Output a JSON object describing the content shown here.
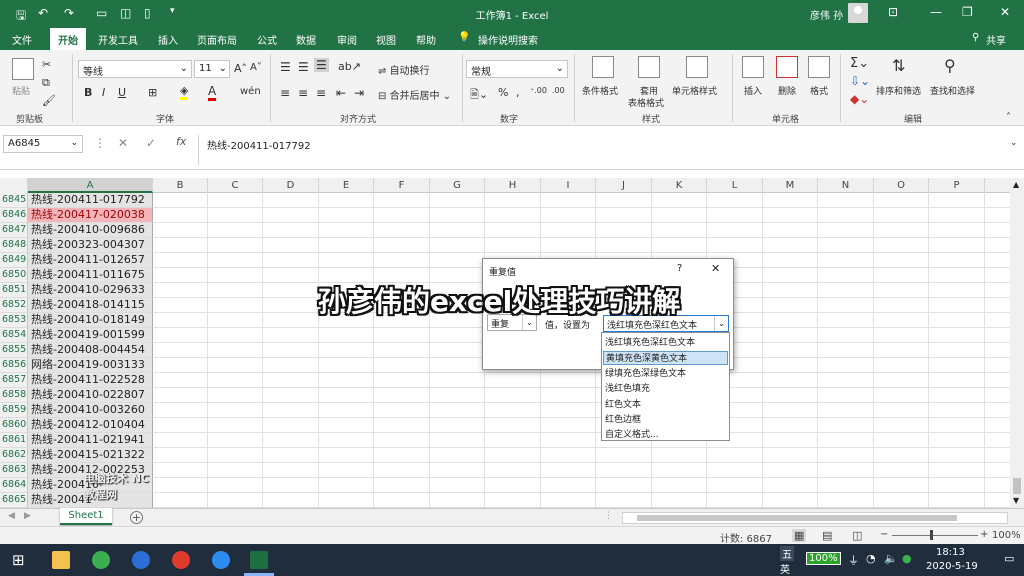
{
  "titlebar": {
    "doc_title": "工作簿1  -  Excel",
    "user_name": "彦伟 孙",
    "quick_access": [
      "save-icon",
      "undo-icon",
      "redo-icon",
      "form-icon",
      "camera-icon",
      "new-icon",
      "customize-icon"
    ]
  },
  "tabs": [
    "文件",
    "开始",
    "开发工具",
    "插入",
    "页面布局",
    "公式",
    "数据",
    "审阅",
    "视图",
    "帮助",
    "操作说明搜索"
  ],
  "share_label": "共享",
  "ribbon": {
    "clipboard": {
      "paste": "粘贴",
      "label": "剪贴板"
    },
    "font": {
      "name": "等线",
      "size": "11",
      "label": "字体",
      "bold": "B",
      "italic": "I",
      "underline": "U"
    },
    "alignment": {
      "wrap": "自动换行",
      "merge": "合并后居中",
      "label": "对齐方式"
    },
    "number": {
      "format": "常规",
      "percent": "%",
      "label": "数字"
    },
    "styles": {
      "conditional": "条件格式",
      "table_fmt_1": "套用",
      "table_fmt_2": "表格格式",
      "cell_style": "单元格样式",
      "label": "样式"
    },
    "cells": {
      "insert": "插入",
      "delete": "删除",
      "format": "格式",
      "label": "单元格"
    },
    "editing": {
      "sort": "排序和筛选",
      "find": "查找和选择",
      "label": "编辑"
    }
  },
  "formula_bar": {
    "name_box": "A6845",
    "fx": "fx",
    "content": "热线-200411-017792"
  },
  "columns": [
    "A",
    "B",
    "C",
    "D",
    "E",
    "F",
    "G",
    "H",
    "I",
    "J",
    "K",
    "L",
    "M",
    "N",
    "O",
    "P"
  ],
  "rows": [
    {
      "num": "6845",
      "value": "热线-200411-017792",
      "dup": false
    },
    {
      "num": "6846",
      "value": "热线-200417-020038",
      "dup": true
    },
    {
      "num": "6847",
      "value": "热线-200410-009686",
      "dup": false
    },
    {
      "num": "6848",
      "value": "热线-200323-004307",
      "dup": false
    },
    {
      "num": "6849",
      "value": "热线-200411-012657",
      "dup": false
    },
    {
      "num": "6850",
      "value": "热线-200411-011675",
      "dup": false
    },
    {
      "num": "6851",
      "value": "热线-200410-029633",
      "dup": false
    },
    {
      "num": "6852",
      "value": "热线-200418-014115",
      "dup": false
    },
    {
      "num": "6853",
      "value": "热线-200410-018149",
      "dup": false
    },
    {
      "num": "6854",
      "value": "热线-200419-001599",
      "dup": false
    },
    {
      "num": "6855",
      "value": "热线-200408-004454",
      "dup": false
    },
    {
      "num": "6856",
      "value": "网络-200419-003133",
      "dup": false
    },
    {
      "num": "6857",
      "value": "热线-200411-022528",
      "dup": false
    },
    {
      "num": "6858",
      "value": "热线-200410-022807",
      "dup": false
    },
    {
      "num": "6859",
      "value": "热线-200410-003260",
      "dup": false
    },
    {
      "num": "6860",
      "value": "热线-200412-010404",
      "dup": false
    },
    {
      "num": "6861",
      "value": "热线-200411-021941",
      "dup": false
    },
    {
      "num": "6862",
      "value": "热线-200415-021322",
      "dup": false
    },
    {
      "num": "6863",
      "value": "热线-200412-002253",
      "dup": false
    },
    {
      "num": "6864",
      "value": "热线-200410-",
      "dup": false
    },
    {
      "num": "6865",
      "value": "热线-20041",
      "dup": false
    }
  ],
  "sheet_tab": "Sheet1",
  "status": {
    "count": "计数: 6867",
    "zoom": "100%"
  },
  "dialog": {
    "title": "重复值",
    "help": "?",
    "close": "✕",
    "dup_option": "重复",
    "value_label": "值，设置为",
    "selected_format": "浅红填充色深红色文本",
    "options": [
      "浅红填充色深红色文本",
      "黄填充色深黄色文本",
      "绿填充色深绿色文本",
      "浅红色填充",
      "红色文本",
      "红色边框",
      "自定义格式..."
    ],
    "highlighted_index": 1
  },
  "overlay_text": "孙彦伟的excel处理技巧讲解",
  "logo_text": "电脑技术 NC教程网",
  "taskbar": {
    "ime_1": "五",
    "ime_2": "英",
    "battery": "100%",
    "time": "18:13",
    "date": "2020-5-19"
  },
  "colors": {
    "excel_green": "#217346",
    "dup_fill": "#f3b5b9",
    "dup_text": "#9c0006"
  }
}
